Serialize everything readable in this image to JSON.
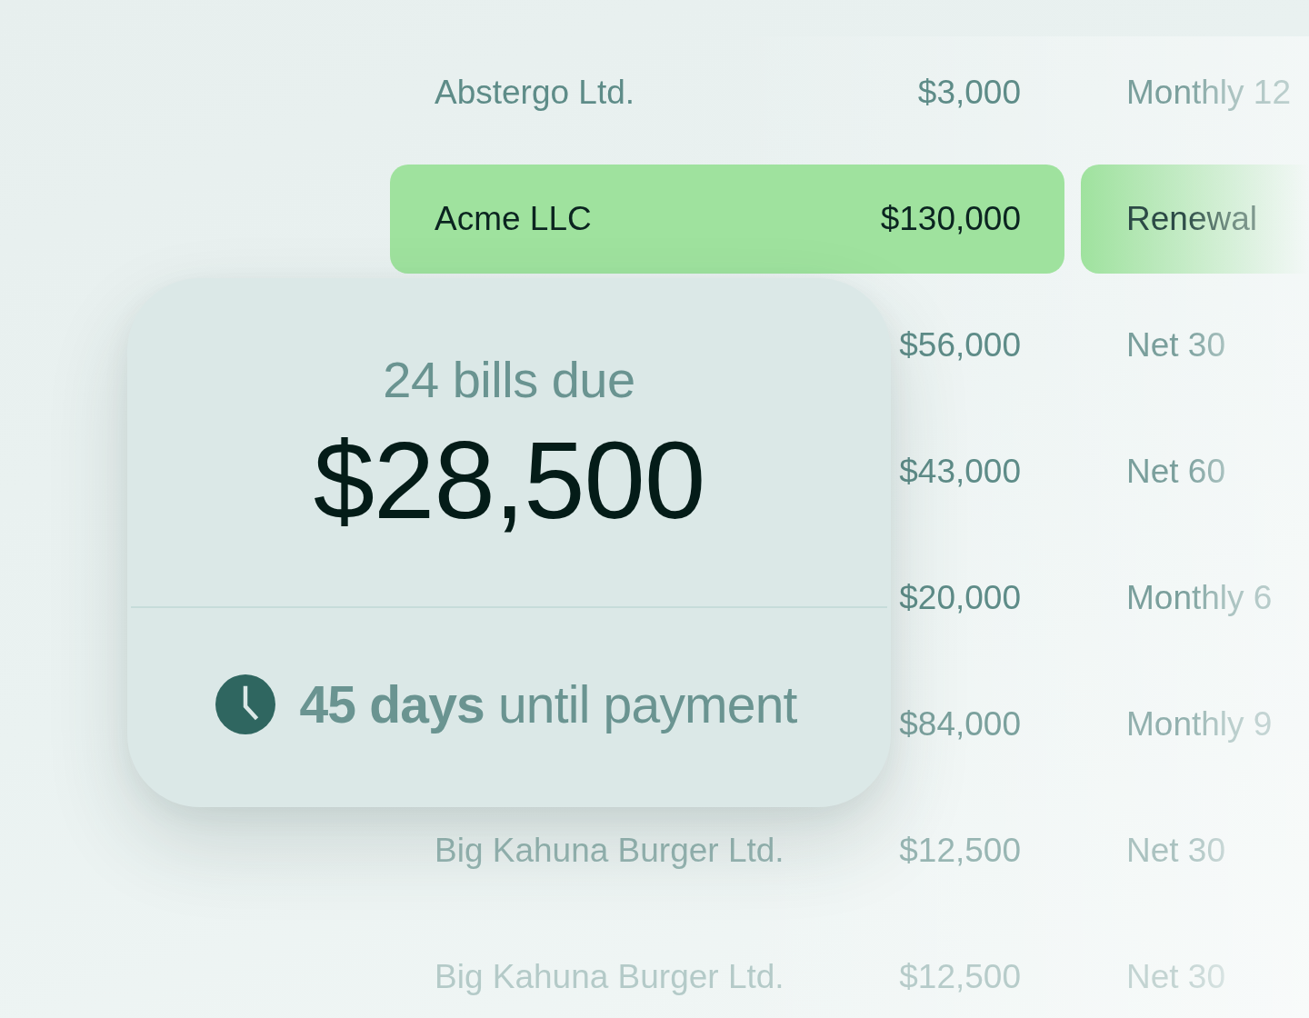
{
  "rows": [
    {
      "name": "Abstergo Ltd.",
      "amount": "$3,000",
      "term": "Monthly 12",
      "selected": false
    },
    {
      "name": "Acme LLC",
      "amount": "$130,000",
      "term": "Renewal",
      "selected": true
    },
    {
      "amount": "$56,000",
      "term": "Net 30",
      "selected": false
    },
    {
      "amount": "$43,000",
      "term": "Net 60",
      "selected": false
    },
    {
      "amount": "$20,000",
      "term": "Monthly 6",
      "selected": false
    },
    {
      "amount": "$84,000",
      "term": "Monthly 9",
      "selected": false
    },
    {
      "name": "Big Kahuna Burger Ltd.",
      "amount": "$12,500",
      "term": "Net 30",
      "selected": false
    },
    {
      "name": "Big Kahuna Burger Ltd.",
      "amount": "$12,500",
      "term": "Net 30",
      "selected": false
    }
  ],
  "summary_card": {
    "bills_due": "24 bills due",
    "total": "$28,500",
    "countdown": "**45 days** until payment"
  }
}
